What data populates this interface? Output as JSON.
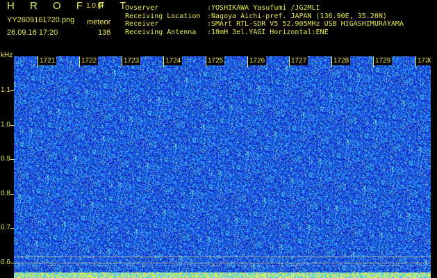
{
  "header": {
    "brand": "H R O F F T",
    "version": "1.0.0f",
    "filename": "YY2609161720.png",
    "datetime": "26.09.16 17:20",
    "label_type": "meteor",
    "count": "136",
    "info": [
      {
        "label": "Ovserver",
        "value": ":YOSHIKAWA Yasufumi /JG2MLI"
      },
      {
        "label": "Receiving Location",
        "value": ":Nagoya Aichi-pref. JAPAN (136.90E, 35.20N)"
      },
      {
        "label": "Receiver",
        "value": ":SMArt RTL-SDR V5 52.905MHz USB HIGASHIMURAYAMA"
      },
      {
        "label": "Receiving Antenna",
        "value": ":10mH 3el.YAGI Horizontal:ENE"
      }
    ]
  },
  "axis": {
    "unit": "kHz",
    "y_ticks": [
      "1.1",
      "1.0",
      "0.9",
      "0.8",
      "0.7",
      "0.6"
    ],
    "x_ticks": [
      "1721",
      "1722",
      "1723",
      "1724",
      "1725",
      "1726",
      "1727",
      "1728",
      "1729",
      "1730"
    ]
  },
  "colors": {
    "label": "#e8e84a",
    "background": "#000000",
    "spectrum_base": "#1a2fd0",
    "spectrum_noise": "#3db4ff",
    "spectrum_hot": "#f2f24a"
  }
}
